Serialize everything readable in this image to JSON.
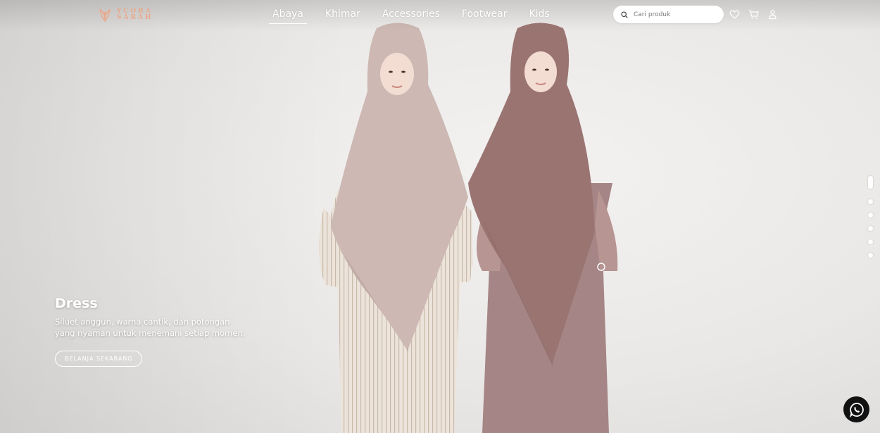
{
  "brand": {
    "logo_text_line1": "YCORA",
    "logo_text_line2": "SARAH"
  },
  "nav": {
    "items": [
      {
        "label": "Abaya",
        "active": true
      },
      {
        "label": "Khimar",
        "active": false
      },
      {
        "label": "Accessories",
        "active": false
      },
      {
        "label": "Footwear",
        "active": false
      },
      {
        "label": "Kids",
        "active": false
      }
    ]
  },
  "search": {
    "placeholder": "Cari produk",
    "icon": "search-icon"
  },
  "header_icons": [
    "heart-icon",
    "cart-icon",
    "user-icon"
  ],
  "hero": {
    "title": "Dress",
    "description": "Siluet anggun, warna cantik, dan potongan yang nyaman untuk menemani setiap momen.",
    "cta_label": "BELANJA SEKARANG"
  },
  "carousel": {
    "slides": 6,
    "active_index": 0
  },
  "whatsapp": {
    "icon": "whatsapp-icon"
  },
  "colors": {
    "accent": "#e8a98c",
    "khimar_light": "#cdb8b3",
    "khimar_mauve": "#9a7471"
  }
}
